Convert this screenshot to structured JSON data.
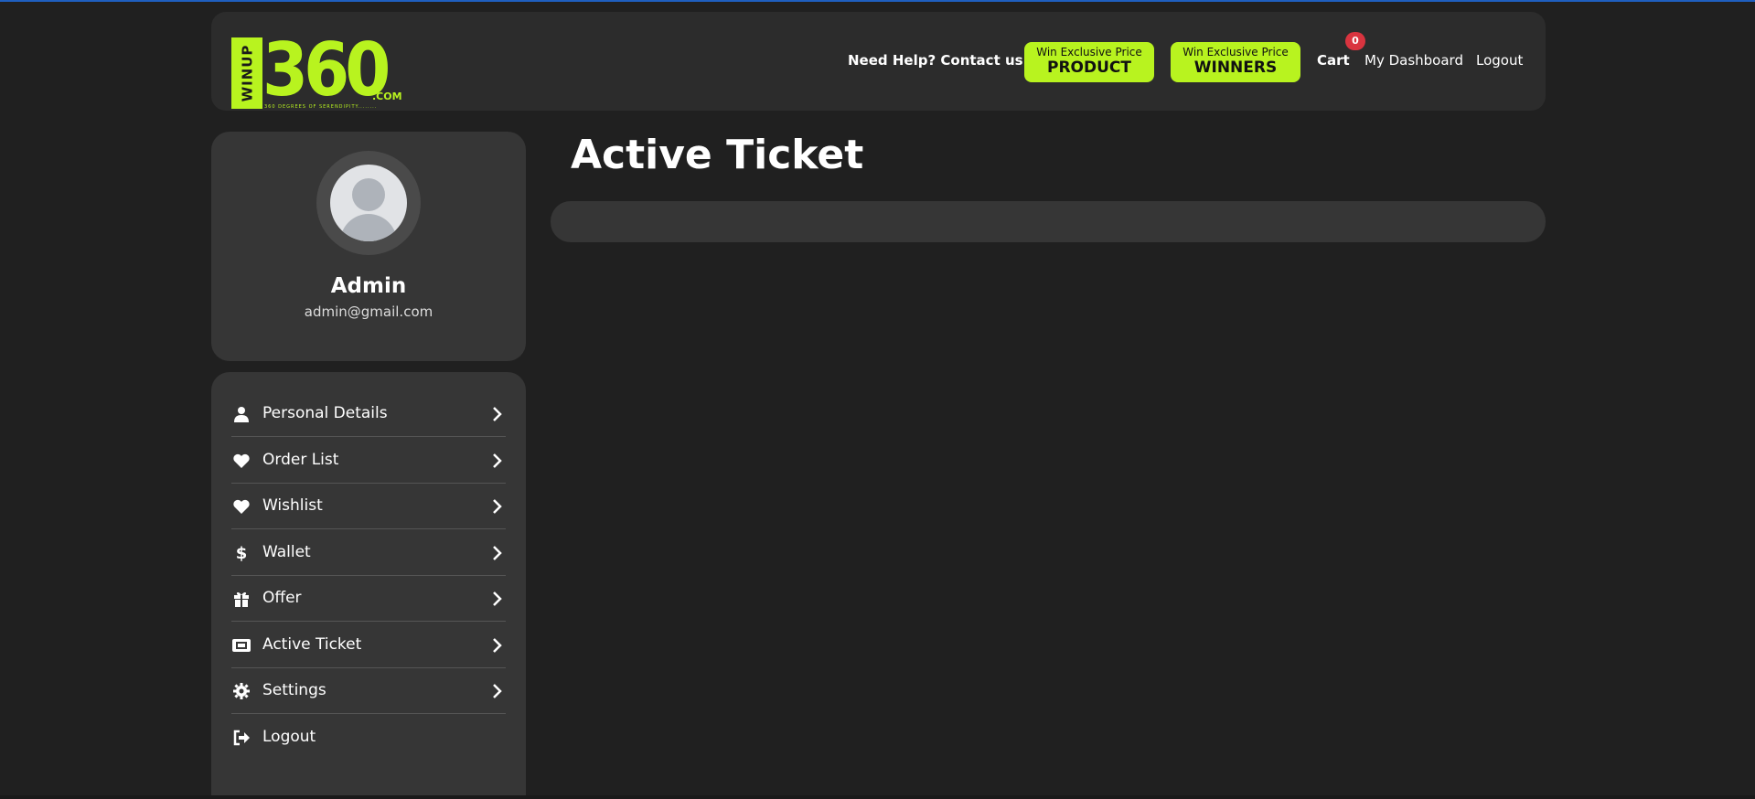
{
  "header": {
    "logo": {
      "vertical_text": "WINUP",
      "number": "360",
      "suffix": ".COM",
      "tagline": "360 DEGREES OF SERENDIPITY........"
    },
    "help_link": "Need Help? Contact us",
    "promo_product": {
      "small": "Win Exclusive Price",
      "big": "PRODUCT"
    },
    "promo_winners": {
      "small": "Win Exclusive Price",
      "big": "WINNERS"
    },
    "cart_label": "Cart",
    "cart_count": "0",
    "dashboard_label": "My Dashboard",
    "logout_label": "Logout"
  },
  "profile": {
    "name": "Admin",
    "email": "admin@gmail.com"
  },
  "menu": {
    "items": [
      {
        "label": "Personal Details",
        "icon": "user-icon"
      },
      {
        "label": "Order List",
        "icon": "heart-icon"
      },
      {
        "label": "Wishlist",
        "icon": "heart-icon"
      },
      {
        "label": "Wallet",
        "icon": "dollar-icon"
      },
      {
        "label": "Offer",
        "icon": "gift-icon"
      },
      {
        "label": "Active Ticket",
        "icon": "ticket-icon"
      },
      {
        "label": "Settings",
        "icon": "gear-icon"
      },
      {
        "label": "Logout",
        "icon": "logout-icon"
      }
    ]
  },
  "main": {
    "title": "Active Ticket"
  },
  "colors": {
    "background": "#202020",
    "card": "#363636",
    "header": "#2c2c2c",
    "accent": "#b8f31f",
    "badge": "#d9343f"
  }
}
